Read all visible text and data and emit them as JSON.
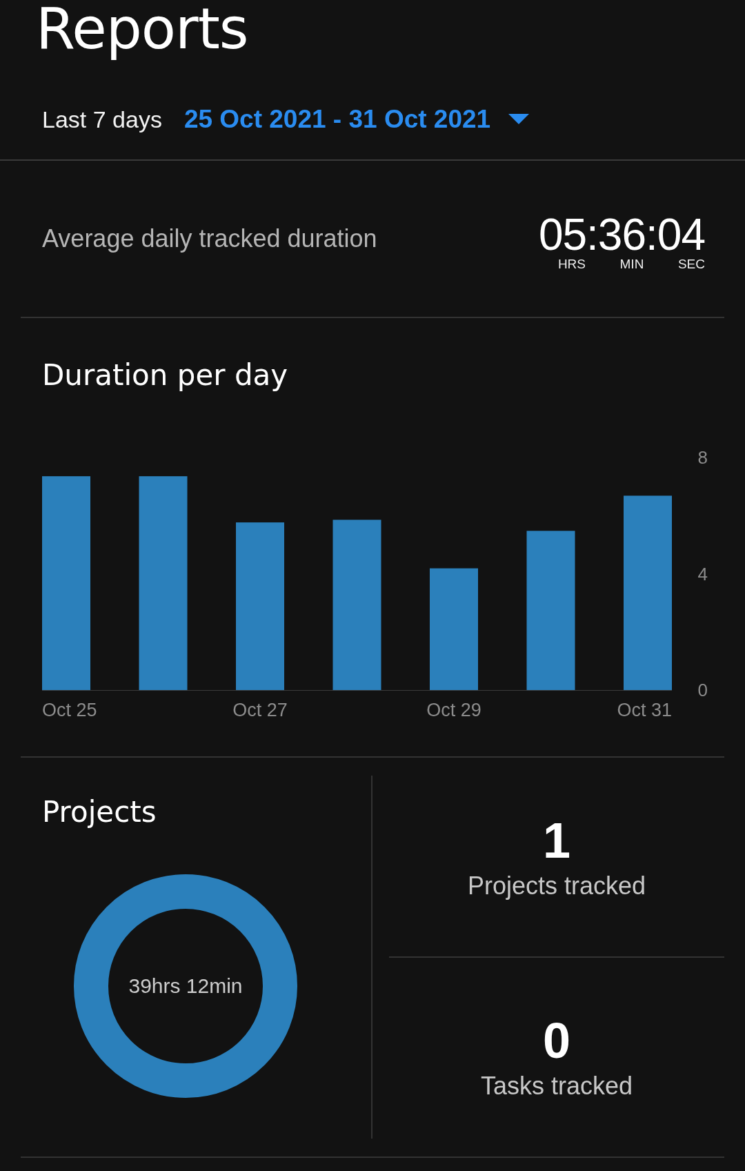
{
  "header": {
    "title": "Reports",
    "range_label": "Last 7 days",
    "date_range": "25 Oct 2021 - 31 Oct 2021"
  },
  "average": {
    "label": "Average daily tracked duration",
    "value": "05:36:04",
    "units": [
      "HRS",
      "MIN",
      "SEC"
    ]
  },
  "duration_chart": {
    "title": "Duration per day",
    "chart_data": {
      "type": "bar",
      "categories": [
        "Oct 25",
        null,
        "Oct 27",
        null,
        "Oct 29",
        null,
        "Oct 31"
      ],
      "values": [
        7.36,
        7.36,
        5.77,
        5.86,
        4.19,
        5.48,
        6.69
      ],
      "ylim": [
        0,
        8
      ],
      "yticks": [
        0,
        4,
        8
      ]
    }
  },
  "projects": {
    "title": "Projects",
    "total": "39hrs 12min",
    "color": "#2b80bb"
  },
  "stats": [
    {
      "value": "1",
      "label": "Projects tracked"
    },
    {
      "value": "0",
      "label": "Tasks tracked"
    }
  ]
}
